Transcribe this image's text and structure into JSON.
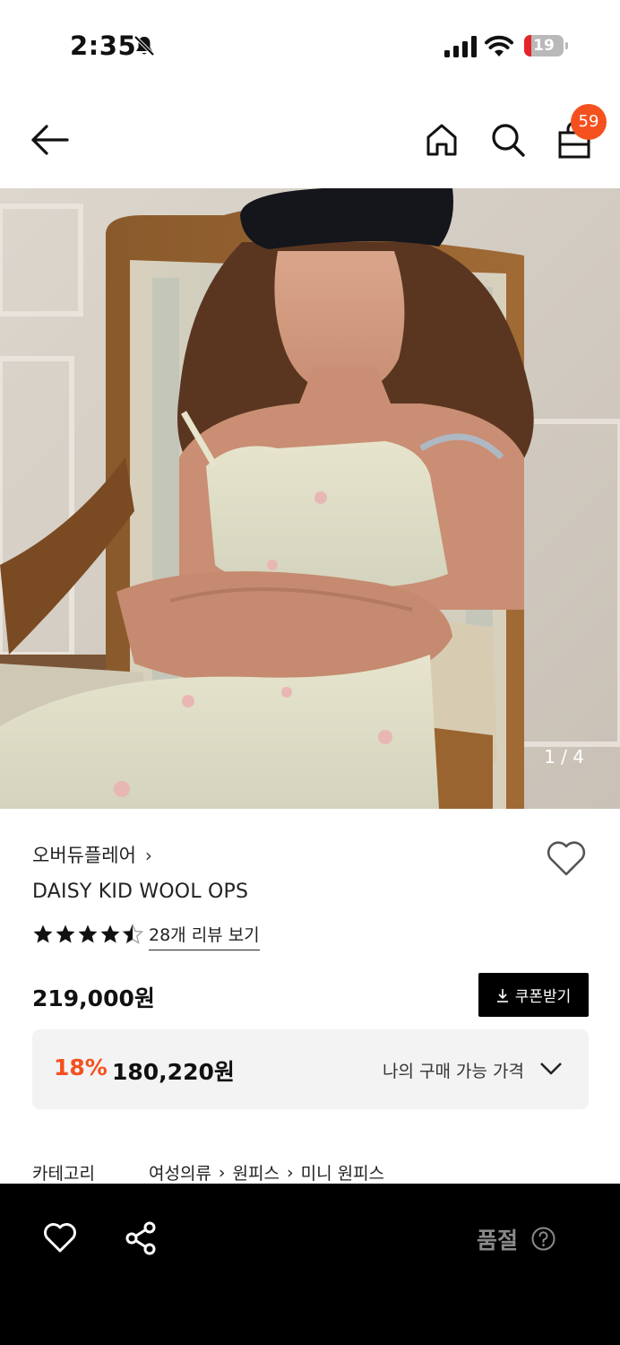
{
  "status_bar": {
    "time": "2:35",
    "battery_percent": "19",
    "battery_level": 0.19,
    "icons": [
      "bell-slash-icon",
      "cellular-signal-icon",
      "wifi-icon",
      "battery-icon"
    ]
  },
  "nav": {
    "icons": [
      "back-arrow-icon",
      "home-icon",
      "search-icon",
      "shopping-bag-icon"
    ],
    "cart_count": "59"
  },
  "gallery": {
    "page_indicator": "1 / 4",
    "current": 1,
    "total": 4
  },
  "product": {
    "brand": "오버듀플레어",
    "name": "DAISY KID WOOL OPS",
    "rating": 4.5,
    "review_link": "28개 리뷰 보기",
    "price_original": "219,000원",
    "coupon_button": "쿠폰받기",
    "discount_percent": "18%",
    "price_final": "180,220원",
    "my_price_label": "나의 구매 가능 가격"
  },
  "category": {
    "label": "카테고리",
    "path": [
      "여성의류",
      "원피스",
      "미니 원피스"
    ]
  },
  "bottom_bar": {
    "status_label": "품절",
    "icons": [
      "heart-outline-icon",
      "share-icon",
      "help-circle-icon"
    ]
  },
  "colors": {
    "accent": "#f4511e",
    "badge": "#f4511e",
    "battery_low": "#e5252b",
    "bottom_bar_bg": "#000000",
    "soldout_text": "#8a8a8a"
  }
}
